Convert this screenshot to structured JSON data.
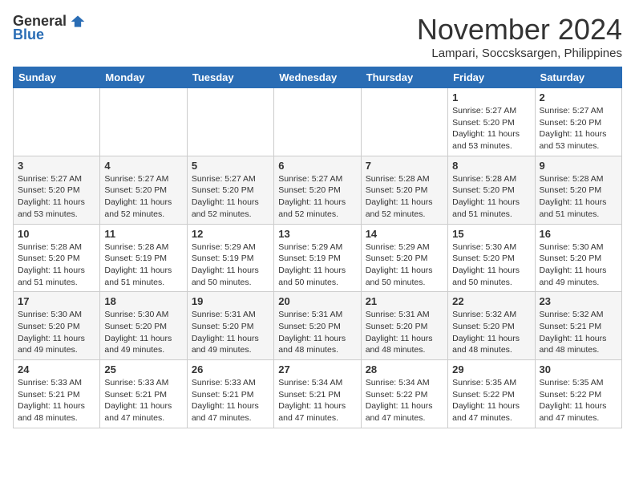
{
  "header": {
    "logo_general": "General",
    "logo_blue": "Blue",
    "month_title": "November 2024",
    "location": "Lampari, Soccsksargen, Philippines"
  },
  "weekdays": [
    "Sunday",
    "Monday",
    "Tuesday",
    "Wednesday",
    "Thursday",
    "Friday",
    "Saturday"
  ],
  "weeks": [
    [
      {
        "day": "",
        "info": ""
      },
      {
        "day": "",
        "info": ""
      },
      {
        "day": "",
        "info": ""
      },
      {
        "day": "",
        "info": ""
      },
      {
        "day": "",
        "info": ""
      },
      {
        "day": "1",
        "info": "Sunrise: 5:27 AM\nSunset: 5:20 PM\nDaylight: 11 hours and 53 minutes."
      },
      {
        "day": "2",
        "info": "Sunrise: 5:27 AM\nSunset: 5:20 PM\nDaylight: 11 hours and 53 minutes."
      }
    ],
    [
      {
        "day": "3",
        "info": "Sunrise: 5:27 AM\nSunset: 5:20 PM\nDaylight: 11 hours and 53 minutes."
      },
      {
        "day": "4",
        "info": "Sunrise: 5:27 AM\nSunset: 5:20 PM\nDaylight: 11 hours and 52 minutes."
      },
      {
        "day": "5",
        "info": "Sunrise: 5:27 AM\nSunset: 5:20 PM\nDaylight: 11 hours and 52 minutes."
      },
      {
        "day": "6",
        "info": "Sunrise: 5:27 AM\nSunset: 5:20 PM\nDaylight: 11 hours and 52 minutes."
      },
      {
        "day": "7",
        "info": "Sunrise: 5:28 AM\nSunset: 5:20 PM\nDaylight: 11 hours and 52 minutes."
      },
      {
        "day": "8",
        "info": "Sunrise: 5:28 AM\nSunset: 5:20 PM\nDaylight: 11 hours and 51 minutes."
      },
      {
        "day": "9",
        "info": "Sunrise: 5:28 AM\nSunset: 5:20 PM\nDaylight: 11 hours and 51 minutes."
      }
    ],
    [
      {
        "day": "10",
        "info": "Sunrise: 5:28 AM\nSunset: 5:20 PM\nDaylight: 11 hours and 51 minutes."
      },
      {
        "day": "11",
        "info": "Sunrise: 5:28 AM\nSunset: 5:19 PM\nDaylight: 11 hours and 51 minutes."
      },
      {
        "day": "12",
        "info": "Sunrise: 5:29 AM\nSunset: 5:19 PM\nDaylight: 11 hours and 50 minutes."
      },
      {
        "day": "13",
        "info": "Sunrise: 5:29 AM\nSunset: 5:19 PM\nDaylight: 11 hours and 50 minutes."
      },
      {
        "day": "14",
        "info": "Sunrise: 5:29 AM\nSunset: 5:20 PM\nDaylight: 11 hours and 50 minutes."
      },
      {
        "day": "15",
        "info": "Sunrise: 5:30 AM\nSunset: 5:20 PM\nDaylight: 11 hours and 50 minutes."
      },
      {
        "day": "16",
        "info": "Sunrise: 5:30 AM\nSunset: 5:20 PM\nDaylight: 11 hours and 49 minutes."
      }
    ],
    [
      {
        "day": "17",
        "info": "Sunrise: 5:30 AM\nSunset: 5:20 PM\nDaylight: 11 hours and 49 minutes."
      },
      {
        "day": "18",
        "info": "Sunrise: 5:30 AM\nSunset: 5:20 PM\nDaylight: 11 hours and 49 minutes."
      },
      {
        "day": "19",
        "info": "Sunrise: 5:31 AM\nSunset: 5:20 PM\nDaylight: 11 hours and 49 minutes."
      },
      {
        "day": "20",
        "info": "Sunrise: 5:31 AM\nSunset: 5:20 PM\nDaylight: 11 hours and 48 minutes."
      },
      {
        "day": "21",
        "info": "Sunrise: 5:31 AM\nSunset: 5:20 PM\nDaylight: 11 hours and 48 minutes."
      },
      {
        "day": "22",
        "info": "Sunrise: 5:32 AM\nSunset: 5:20 PM\nDaylight: 11 hours and 48 minutes."
      },
      {
        "day": "23",
        "info": "Sunrise: 5:32 AM\nSunset: 5:21 PM\nDaylight: 11 hours and 48 minutes."
      }
    ],
    [
      {
        "day": "24",
        "info": "Sunrise: 5:33 AM\nSunset: 5:21 PM\nDaylight: 11 hours and 48 minutes."
      },
      {
        "day": "25",
        "info": "Sunrise: 5:33 AM\nSunset: 5:21 PM\nDaylight: 11 hours and 47 minutes."
      },
      {
        "day": "26",
        "info": "Sunrise: 5:33 AM\nSunset: 5:21 PM\nDaylight: 11 hours and 47 minutes."
      },
      {
        "day": "27",
        "info": "Sunrise: 5:34 AM\nSunset: 5:21 PM\nDaylight: 11 hours and 47 minutes."
      },
      {
        "day": "28",
        "info": "Sunrise: 5:34 AM\nSunset: 5:22 PM\nDaylight: 11 hours and 47 minutes."
      },
      {
        "day": "29",
        "info": "Sunrise: 5:35 AM\nSunset: 5:22 PM\nDaylight: 11 hours and 47 minutes."
      },
      {
        "day": "30",
        "info": "Sunrise: 5:35 AM\nSunset: 5:22 PM\nDaylight: 11 hours and 47 minutes."
      }
    ]
  ]
}
